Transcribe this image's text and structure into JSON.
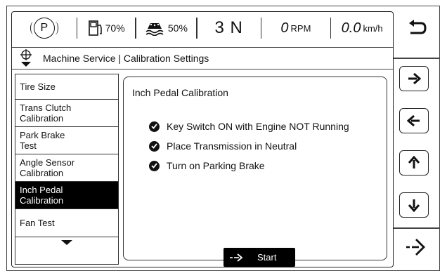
{
  "status_bar": {
    "gear_indicator": "P",
    "fuel_percent": "70%",
    "def_percent": "50%",
    "transmission": "3 N",
    "rpm_value": "0",
    "rpm_unit": "RPM",
    "speed_value": "0.0",
    "speed_unit": "km/h"
  },
  "breadcrumb": {
    "title": "Machine Service | Calibration Settings"
  },
  "menu": {
    "items": [
      {
        "label": "Tire Size"
      },
      {
        "label": "Trans Clutch Calibration"
      },
      {
        "label": "Park Brake Test"
      },
      {
        "label": "Angle Sensor Calibration"
      },
      {
        "label": "Inch Pedal Calibration"
      },
      {
        "label": "Fan Test"
      }
    ],
    "selected_index": 4
  },
  "panel": {
    "title": "Inch Pedal Calibration",
    "checklist": [
      {
        "text": "Key Switch ON with Engine NOT Running"
      },
      {
        "text": "Place Transmission in Neutral"
      },
      {
        "text": "Turn on Parking Brake"
      }
    ],
    "start_label": "Start"
  },
  "side_buttons": [
    {
      "icon": "back-icon"
    },
    {
      "icon": "arrow-right-icon"
    },
    {
      "icon": "arrow-left-icon"
    },
    {
      "icon": "arrow-up-icon"
    },
    {
      "icon": "arrow-down-icon"
    },
    {
      "icon": "enter-icon"
    }
  ]
}
